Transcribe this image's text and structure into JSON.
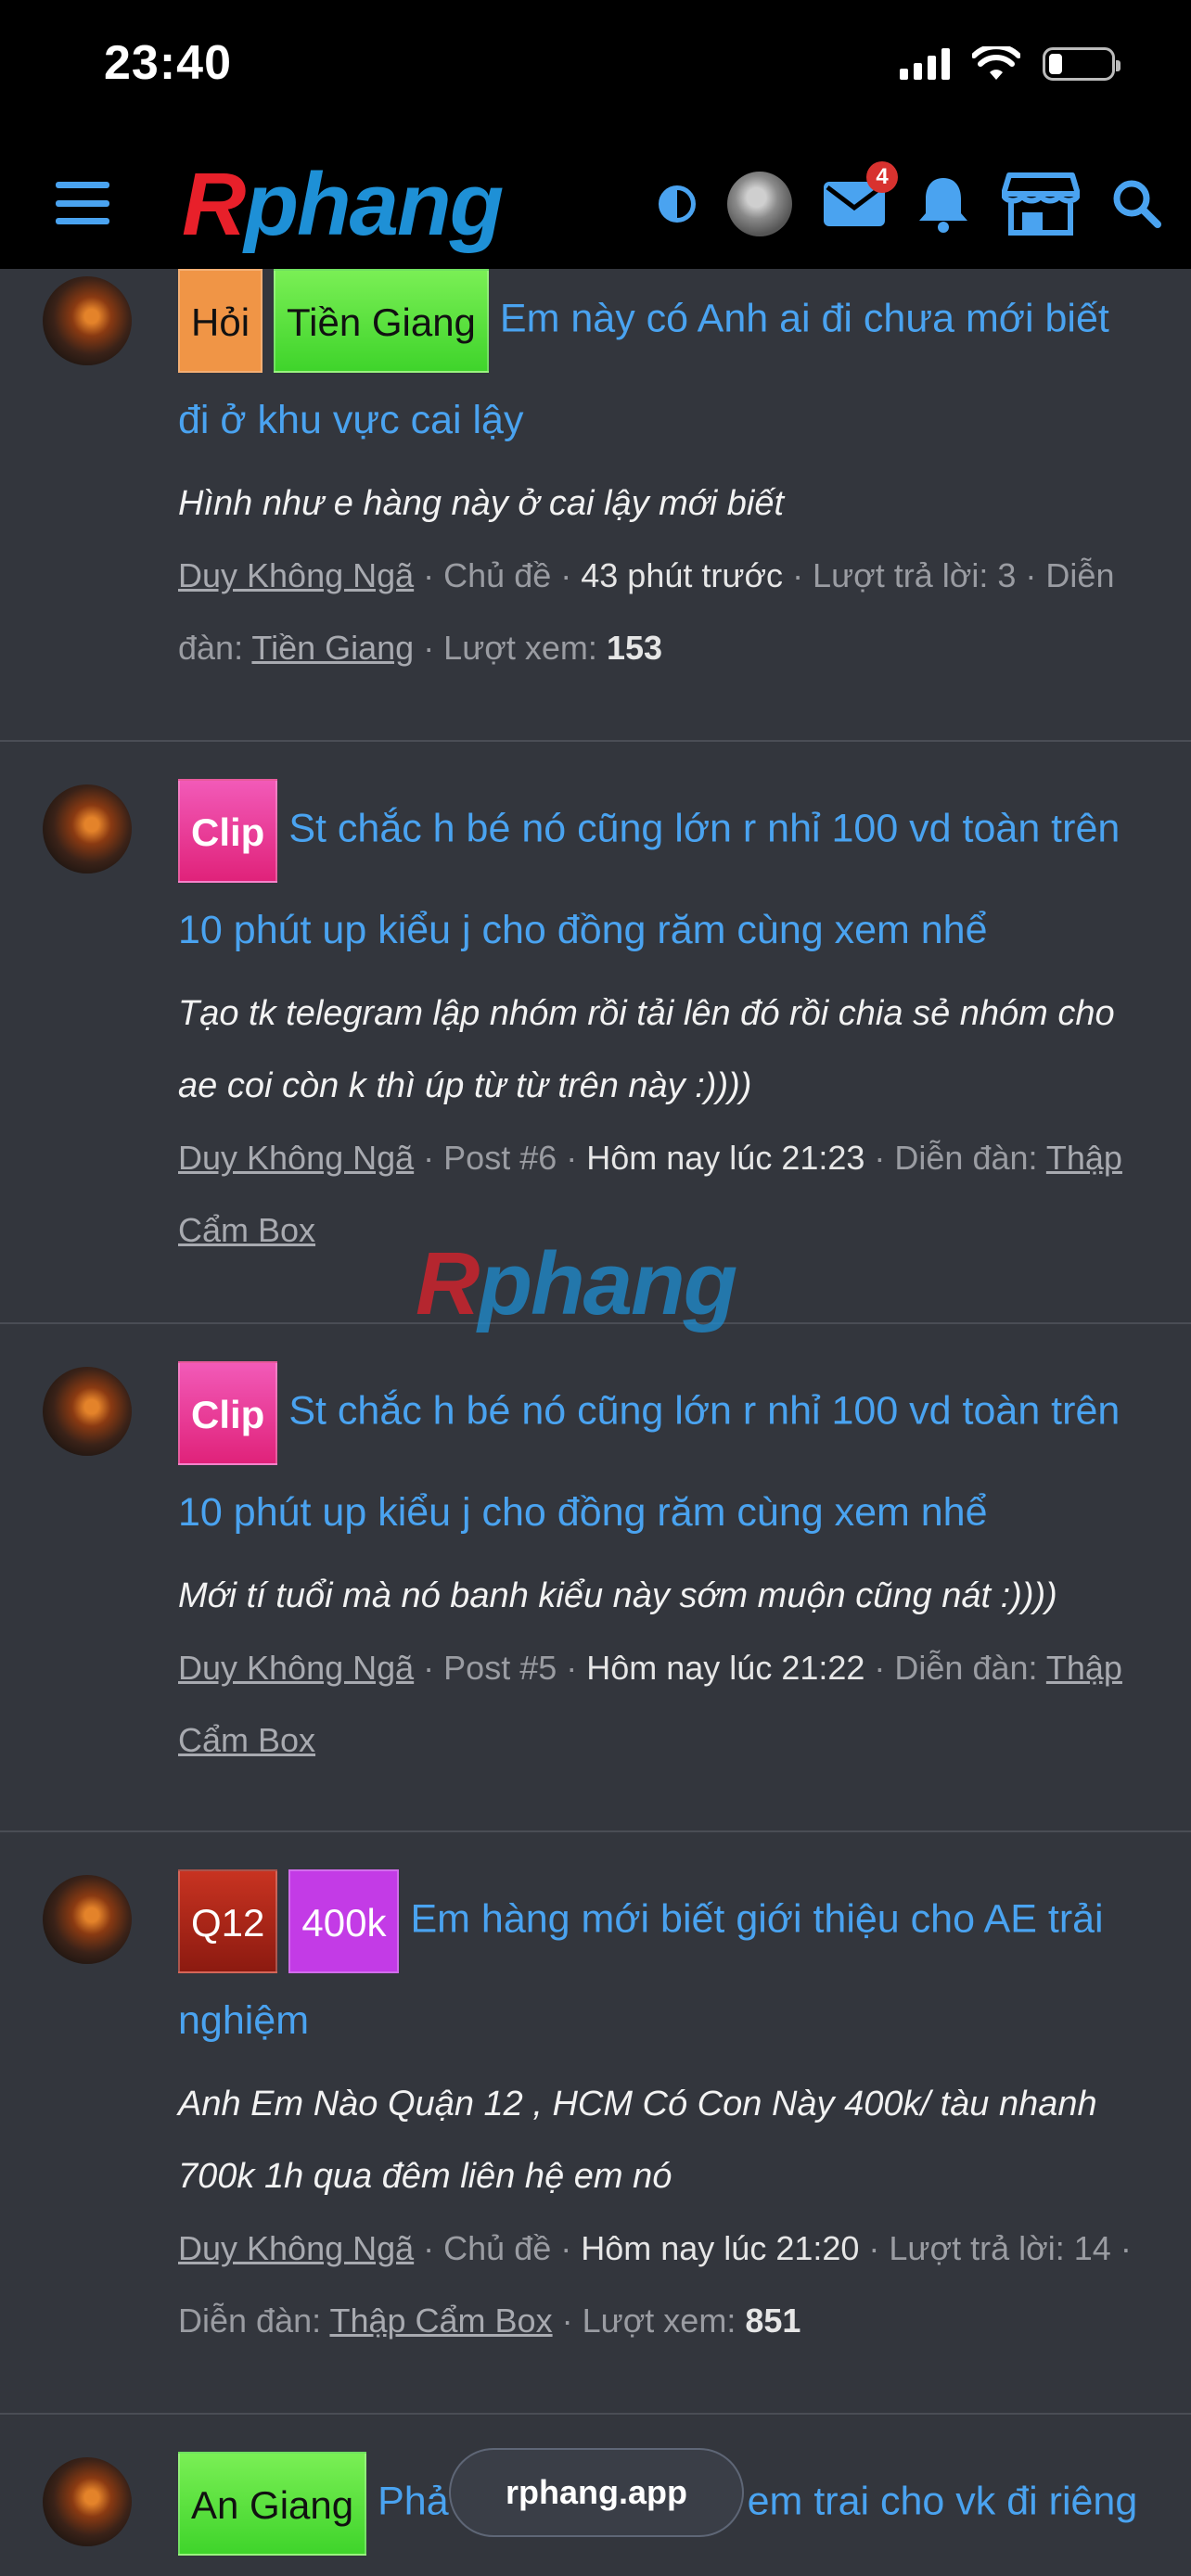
{
  "status_bar": {
    "time": "23:40",
    "battery_level": 0.22
  },
  "header": {
    "logo": {
      "first": "R",
      "rest": "phang"
    },
    "mail_badge": "4",
    "icons": [
      "menu-icon",
      "contrast-icon",
      "avatar",
      "mail-icon",
      "bell-icon",
      "store-icon",
      "search-icon"
    ]
  },
  "watermark": {
    "first": "R",
    "rest": "phang"
  },
  "floating_url": "rphang.app",
  "items": [
    {
      "tags": [
        "Hỏi",
        "Tiền Giang"
      ],
      "title": "Em này có Anh ai đi chưa mới biết đi ở khu vực cai lậy",
      "snippet": "Hình như e hàng này ở cai lậy mới biết",
      "meta": {
        "author": "Duy Không Ngã",
        "sep1": " · Chủ đề · ",
        "time": "43 phút trước",
        "sep2": " · Lượt trả lời: 3 · Diễn đàn: ",
        "forum": "Tiền Giang",
        "views_label": " · Lượt xem: ",
        "views": "153"
      }
    },
    {
      "tags": [
        "Clip"
      ],
      "title": "St chắc h bé nó cũng lớn r nhỉ 100 vd toàn trên 10 phút up kiểu j cho đồng răm cùng xem nhể",
      "snippet": "Tạo tk telegram lập nhóm rồi tải lên đó rồi chia sẻ nhóm cho ae coi còn k thì úp từ từ trên này :))))",
      "meta": {
        "author": "Duy Không Ngã",
        "sep1": " · Post #6 · ",
        "time": "Hôm nay lúc 21:23",
        "sep2": " · Diễn đàn: ",
        "forum": "Thập Cẩm Box"
      }
    },
    {
      "tags": [
        "Clip"
      ],
      "title": "St chắc h bé nó cũng lớn r nhỉ 100 vd toàn trên 10 phút up kiểu j cho đồng răm cùng xem nhể",
      "snippet": "Mới tí tuổi mà nó banh kiểu này sớm muộn cũng nát :))))",
      "meta": {
        "author": "Duy Không Ngã",
        "sep1": " · Post #5 · ",
        "time": "Hôm nay lúc 21:22",
        "sep2": " · Diễn đàn: ",
        "forum": "Thập Cẩm Box"
      }
    },
    {
      "tags": [
        "Q12",
        "400k"
      ],
      "title": "Em hàng mới biết giới thiệu cho AE trải nghiệm",
      "snippet": "Anh Em Nào Quận 12 , HCM Có Con Này 400k/ tàu nhanh 700k 1h qua đêm liên hệ em nó",
      "meta": {
        "author": "Duy Không Ngã",
        "sep1": " · Chủ đề · ",
        "time": "Hôm nay lúc 21:20",
        "sep2": " · Lượt trả lời: 14 · Diễn đàn: ",
        "forum": "Thập Cẩm Box",
        "views_label": " · Lượt xem: ",
        "views": "851"
      }
    },
    {
      "tags": [
        "An Giang"
      ],
      "title_start": "Phả",
      "title_end": "em trai cho vk đi riêng"
    }
  ]
}
